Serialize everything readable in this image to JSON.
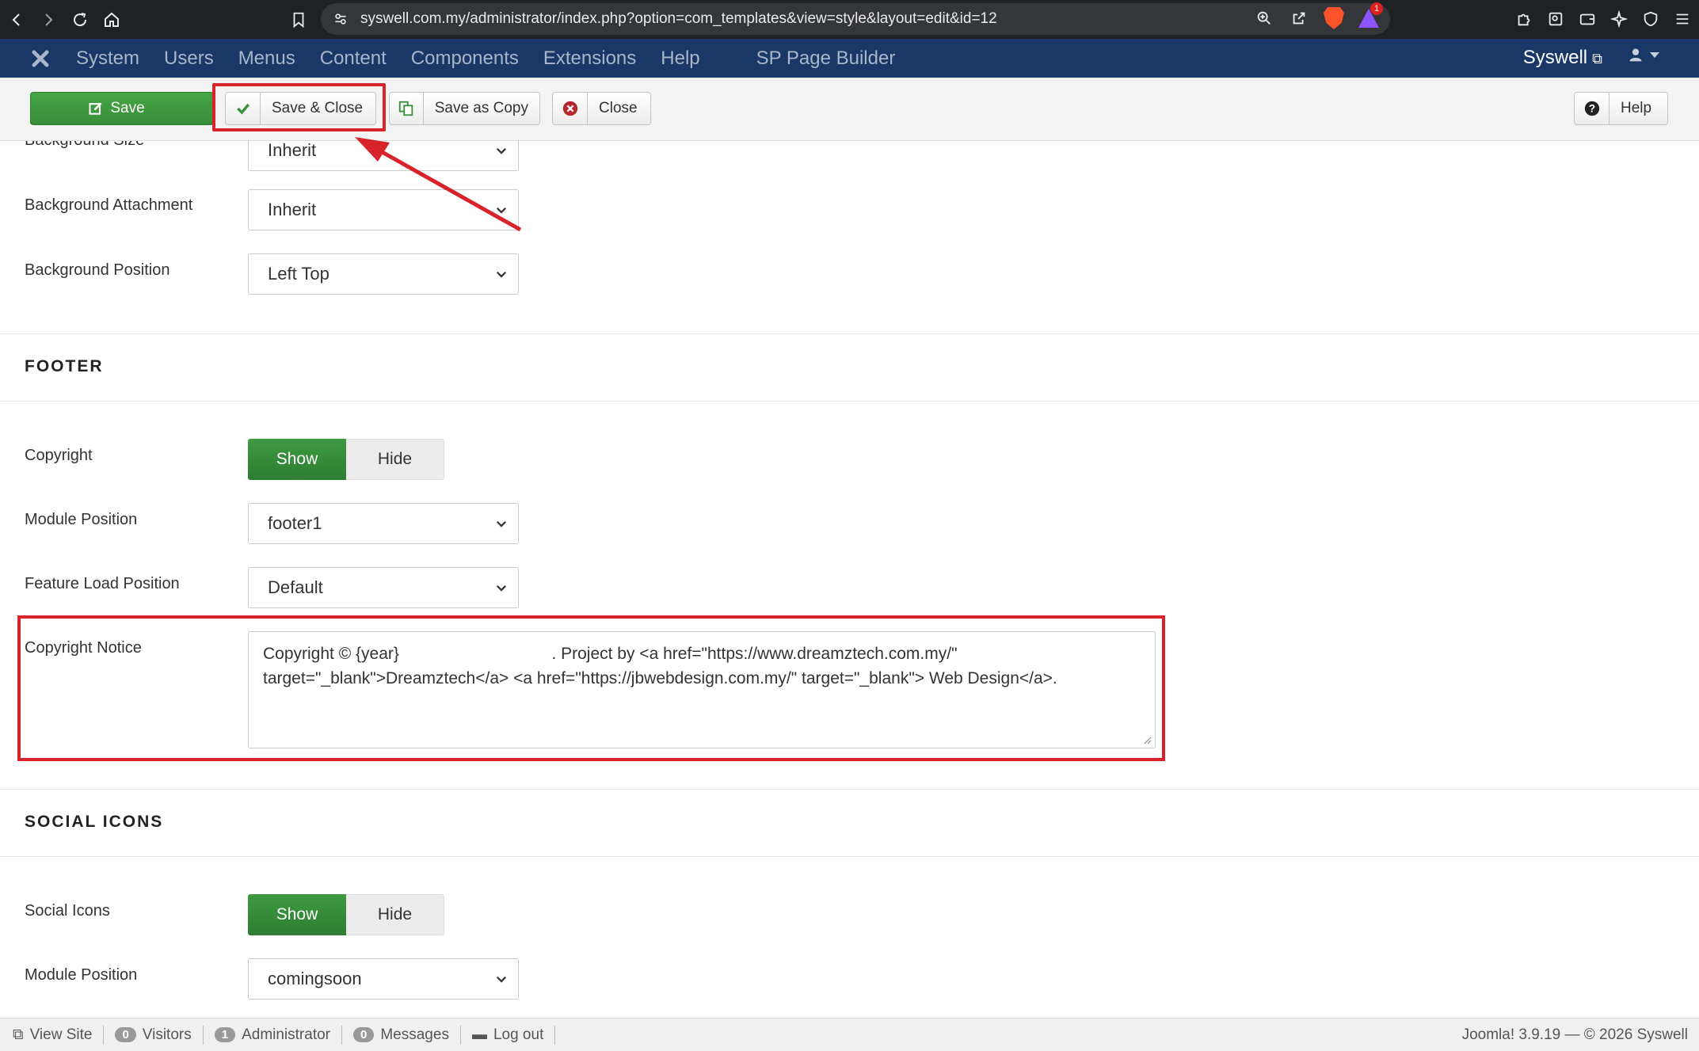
{
  "browser": {
    "url": "syswell.com.my/administrator/index.php?option=com_templates&view=style&layout=edit&id=12",
    "badge_count": "1"
  },
  "nav": {
    "menus": [
      "System",
      "Users",
      "Menus",
      "Content",
      "Components",
      "Extensions",
      "Help"
    ],
    "extra_menu": "SP Page Builder",
    "site_name": "Syswell"
  },
  "toolbar": {
    "save": "Save",
    "save_close": "Save & Close",
    "save_copy": "Save as Copy",
    "close": "Close",
    "help": "Help"
  },
  "background": {
    "size_label": "Background Size",
    "size_value": "Inherit",
    "attachment_label": "Background Attachment",
    "attachment_value": "Inherit",
    "position_label": "Background Position",
    "position_value": "Left Top"
  },
  "footer": {
    "title": "FOOTER",
    "copyright_label": "Copyright",
    "copyright_on": "Show",
    "copyright_off": "Hide",
    "module_position_label": "Module Position",
    "module_position_value": "footer1",
    "feature_load_label": "Feature Load Position",
    "feature_load_value": "Default",
    "notice_label": "Copyright Notice",
    "notice_line1": "Copyright © {year}                                 . Project by <a href=\"https://www.dreamztech.com.my/\"",
    "notice_line2": "target=\"_blank\">Dreamztech</a> <a href=\"https://jbwebdesign.com.my/\" target=\"_blank\"> Web Design</a>."
  },
  "social": {
    "title": "SOCIAL ICONS",
    "icons_label": "Social Icons",
    "icons_on": "Show",
    "icons_off": "Hide",
    "module_position_label": "Module Position",
    "module_position_value": "comingsoon"
  },
  "status": {
    "view_site": "View Site",
    "visitors_count": "0",
    "visitors": "Visitors",
    "admin_count": "1",
    "admin": "Administrator",
    "messages_count": "0",
    "messages": "Messages",
    "logout": "Log out",
    "version": "Joomla! 3.9.19  —  © 2026 Syswell"
  },
  "colors": {
    "nav_bg": "#1a3867",
    "save_green": "#46a546",
    "highlight_red": "#d9232a"
  }
}
